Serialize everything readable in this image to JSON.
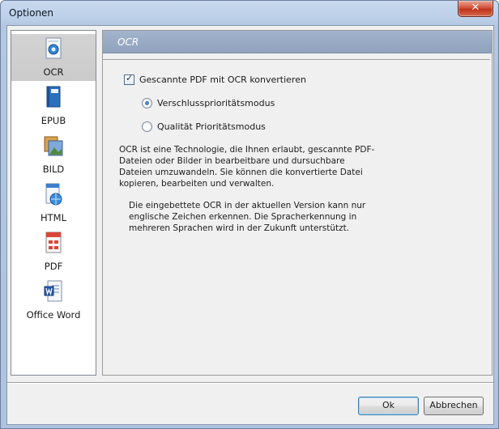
{
  "window": {
    "title": "Optionen",
    "close_glyph": "✕"
  },
  "sidebar": {
    "items": [
      {
        "label": "OCR",
        "icon": "ocr-icon",
        "selected": true
      },
      {
        "label": "EPUB",
        "icon": "epub-icon",
        "selected": false
      },
      {
        "label": "BILD",
        "icon": "image-icon",
        "selected": false
      },
      {
        "label": "HTML",
        "icon": "html-icon",
        "selected": false
      },
      {
        "label": "PDF",
        "icon": "pdf-icon",
        "selected": false
      },
      {
        "label": "Office Word",
        "icon": "word-icon",
        "selected": false
      }
    ]
  },
  "panel": {
    "title": "OCR",
    "convert_checkbox_label": "Gescannte PDF mit OCR konvertieren",
    "convert_checked": true,
    "radio_options": [
      {
        "label": "Verschlussprioritätsmodus",
        "checked": true
      },
      {
        "label": "Qualität Prioritätsmodus",
        "checked": false
      }
    ],
    "description1": "OCR ist eine Technologie, die Ihnen erlaubt, gescannte PDF-Dateien oder Bilder in bearbeitbare und dursuchbare Dateien umzuwandeln. Sie können die konvertierte Datei kopieren, bearbeiten und verwalten.",
    "description2": "Die eingebettete OCR in der aktuellen Version kann nur englische Zeichen erkennen. Die Spracherkennung in mehreren Sprachen wird in der Zukunft unterstützt."
  },
  "buttons": {
    "ok": "Ok",
    "cancel": "Abbrechen"
  },
  "colors": {
    "accent": "#3c7fb1",
    "header": "#97a9c3",
    "selected_item": "#cfcfcf"
  }
}
